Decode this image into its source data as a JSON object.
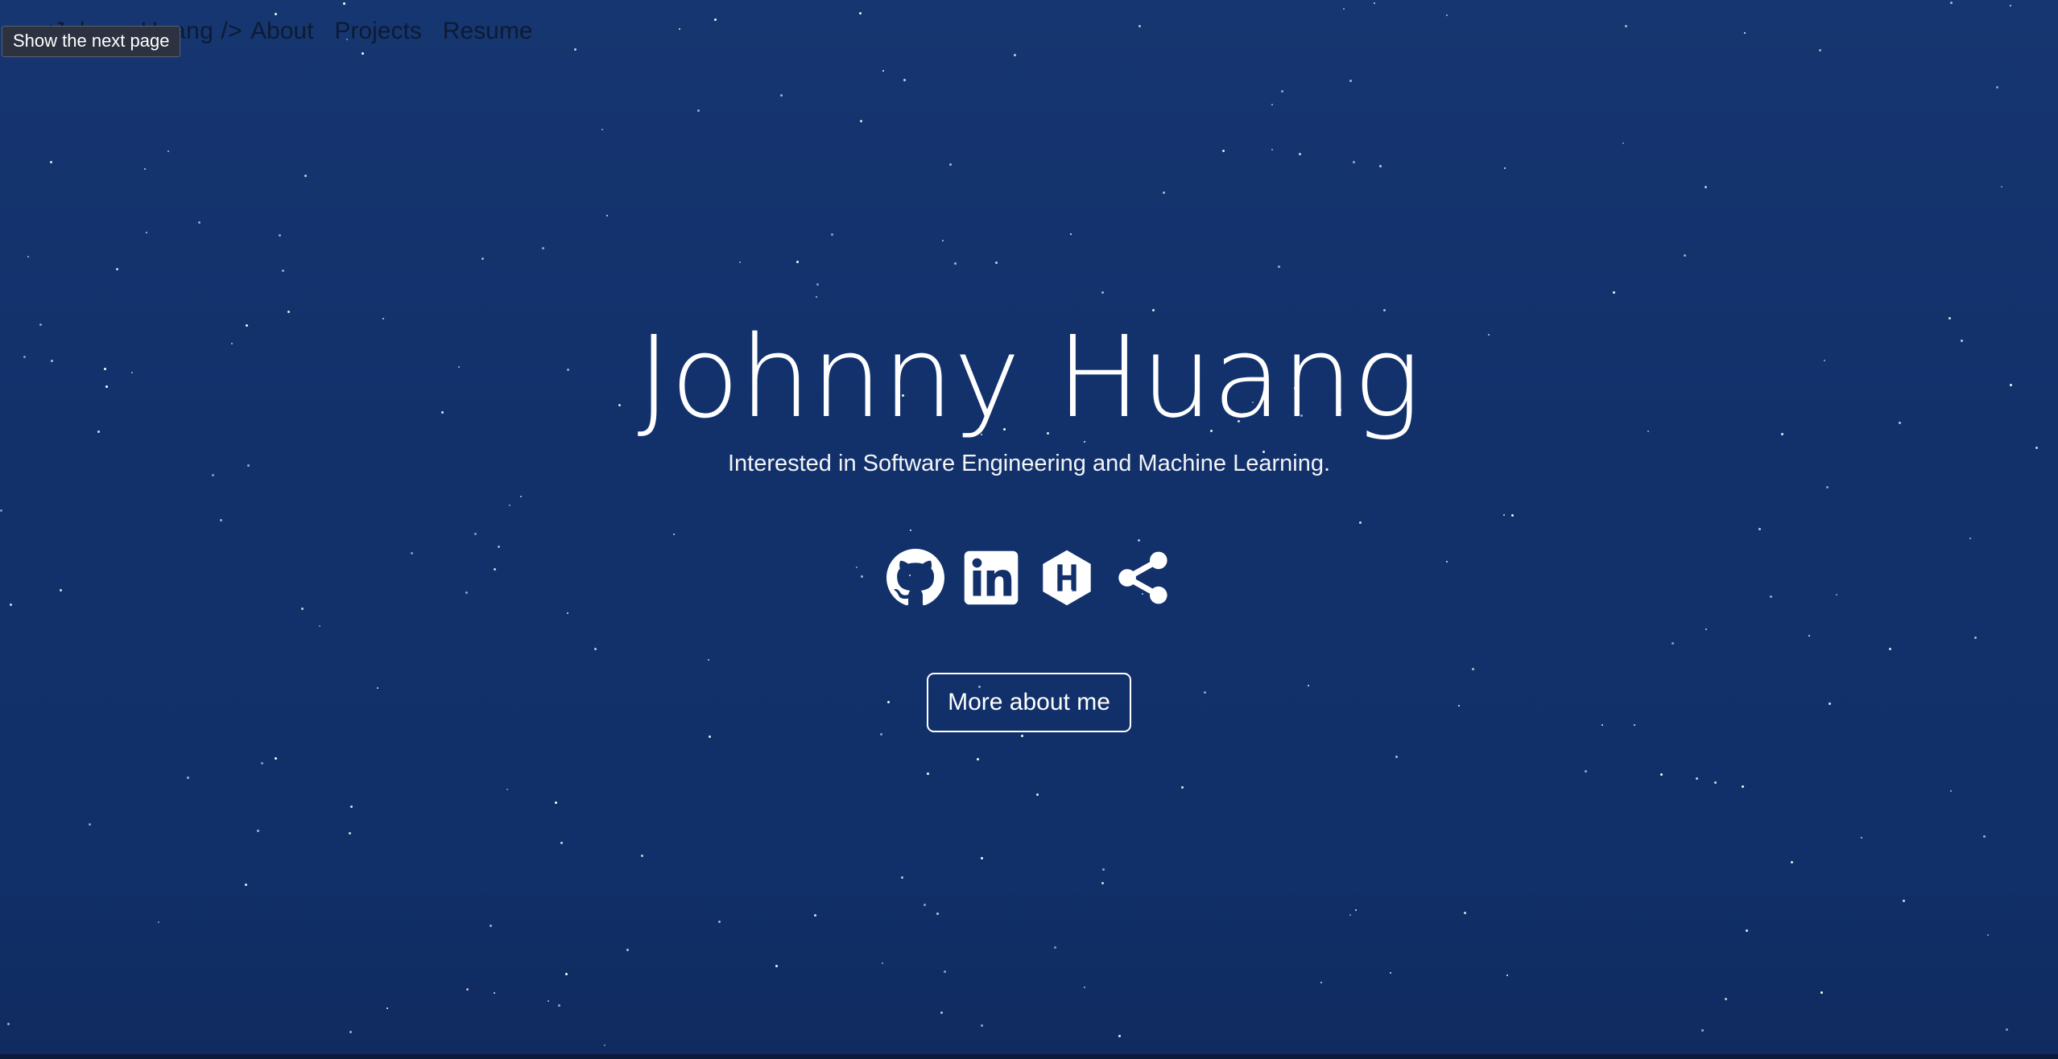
{
  "navbar": {
    "brand": "<Johnny Huang />",
    "links": [
      "About",
      "Projects",
      "Resume"
    ]
  },
  "tooltip": "Show the next page",
  "hero": {
    "title": "Johnny Huang",
    "subtitle": "Interested in Software Engineering and Machine Learning.",
    "socials": [
      {
        "icon": "github-icon"
      },
      {
        "icon": "linkedin-icon"
      },
      {
        "icon": "hackerrank-icon"
      },
      {
        "icon": "share-icon"
      }
    ],
    "cta_label": "More about me"
  },
  "colors": {
    "background": "#12306a",
    "text": "#ffffff",
    "nav_text": "#0d1b33"
  }
}
